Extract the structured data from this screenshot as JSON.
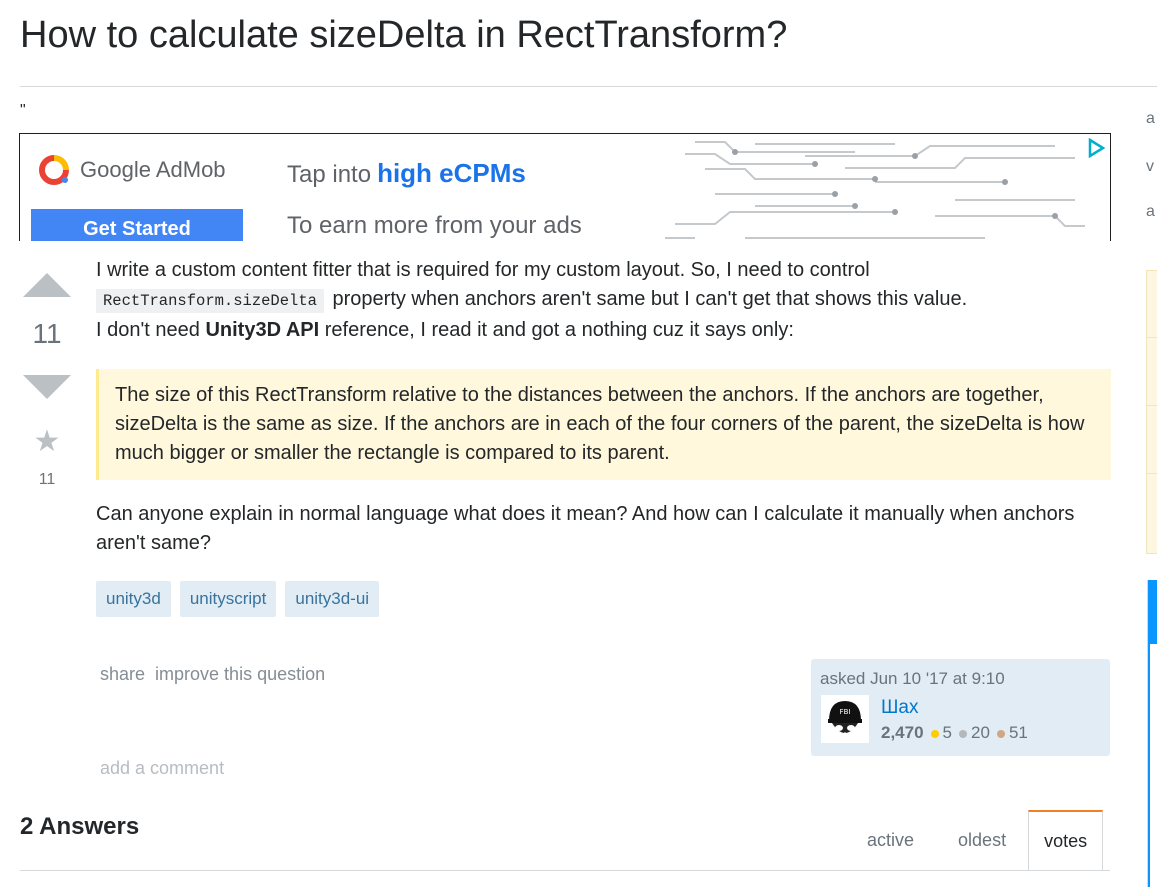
{
  "question": {
    "title": "How to calculate sizeDelta in RectTransform?",
    "quote_mark": "\"",
    "votes": "11",
    "favorites": "11",
    "body": {
      "p1_before": "I write a custom content fitter that is required for my custom layout. So, I need to control",
      "code": "RectTransform.sizeDelta",
      "p1_after": "property when anchors aren't same but I can't get that shows this value.",
      "p2_before": "I don't need",
      "p2_bold": "Unity3D API",
      "p2_after": "reference, I read it and got a nothing cuz it says only:",
      "blockquote": "The size of this RectTransform relative to the distances between the anchors. If the anchors are together, sizeDelta is the same as size. If the anchors are in each of the four corners of the parent, the sizeDelta is how much bigger or smaller the rectangle is compared to its parent.",
      "p3": "Can anyone explain in normal language what does it mean? And how can I calculate it manually when anchors aren't same?"
    },
    "tags": [
      "unity3d",
      "unityscript",
      "unity3d-ui"
    ],
    "menu": {
      "share": "share",
      "improve": "improve this question"
    },
    "asked": {
      "label": "asked Jun 10 '17 at 9:10",
      "user": "Шах",
      "reputation": "2,470",
      "gold": "5",
      "silver": "20",
      "bronze": "51",
      "badge_colors": {
        "gold": "#ffcc01",
        "silver": "#b4b8bc",
        "bronze": "#d1a684"
      }
    },
    "add_comment": "add a comment"
  },
  "ad": {
    "brand": "Google AdMob",
    "cta": "Get Started",
    "headline_lead": "Tap into",
    "headline_strong": "high eCPMs",
    "subline": "To earn more from your ads"
  },
  "sidebar": {
    "letters": [
      "a",
      "v",
      "a"
    ]
  },
  "answers": {
    "title": "2 Answers",
    "tabs": [
      "active",
      "oldest",
      "votes"
    ],
    "active_tab": "votes"
  },
  "colors": {
    "link": "#0077cc",
    "tag_bg": "#e1ecf4",
    "tag_text": "#39739d",
    "accent": "#f48024"
  }
}
